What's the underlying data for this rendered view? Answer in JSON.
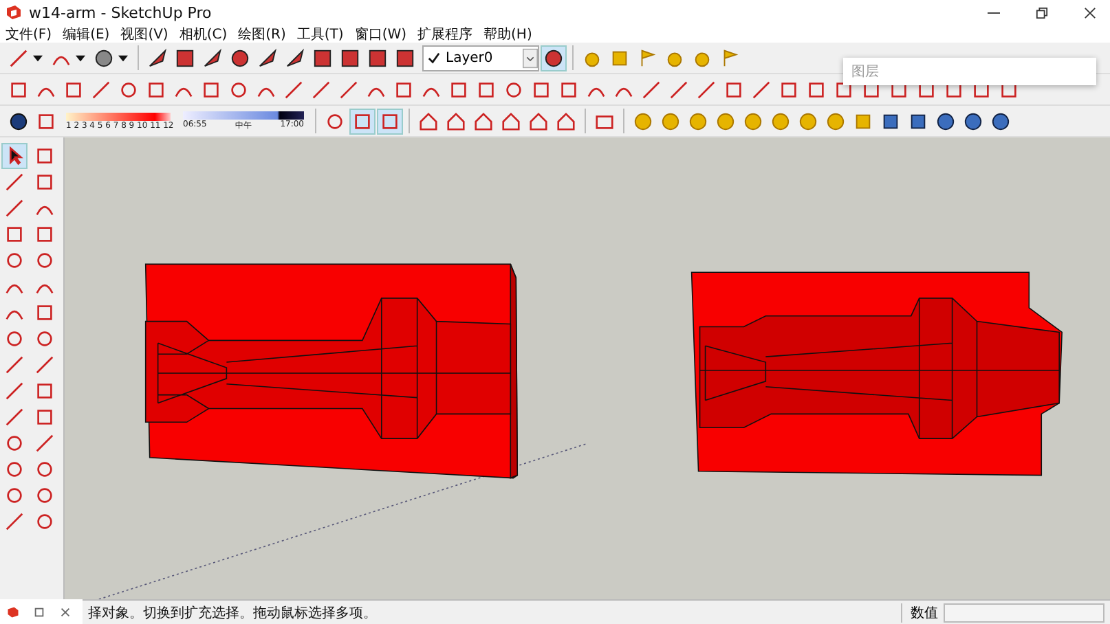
{
  "window": {
    "title": "w14-arm - SketchUp Pro"
  },
  "menu": [
    {
      "label": "文件(F)"
    },
    {
      "label": "编辑(E)"
    },
    {
      "label": "视图(V)"
    },
    {
      "label": "相机(C)"
    },
    {
      "label": "绘图(R)"
    },
    {
      "label": "工具(T)"
    },
    {
      "label": "窗口(W)"
    },
    {
      "label": "扩展程序"
    },
    {
      "label": "帮助(H)"
    }
  ],
  "layer_dropdown": {
    "value": "Layer0"
  },
  "shadow_legend": {
    "months": "1 2 3 4 5 6 7 8 9 10 11 12",
    "time_start": "06:55",
    "time_noon": "中午",
    "time_end": "17:00"
  },
  "tray_panel": {
    "title": "图层"
  },
  "status_bar": {
    "hint": "择对象。切换到扩充选择。拖动鼠标选择多项。",
    "measurements_label": "数值"
  }
}
